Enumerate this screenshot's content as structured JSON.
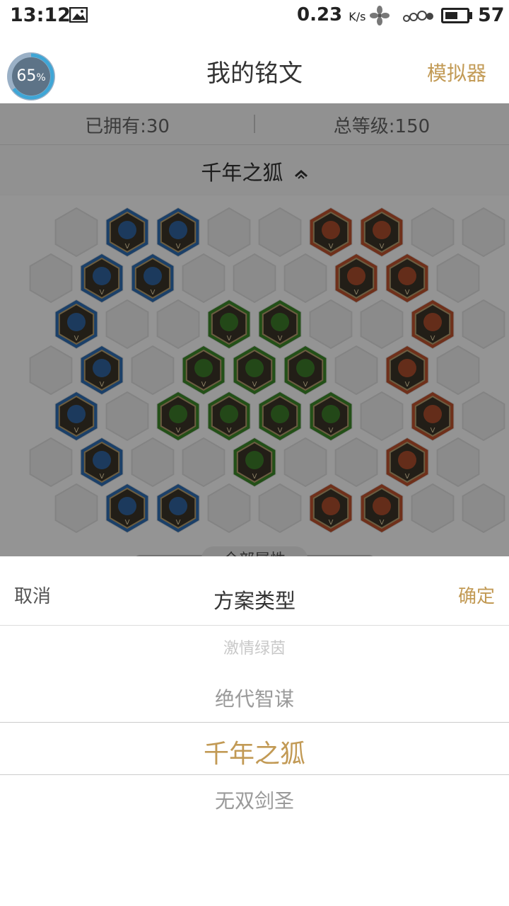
{
  "status_bar": {
    "time": "13:12",
    "net_speed": "0.23",
    "net_speed_unit": "K/s",
    "battery_level": "57",
    "battery_fraction": 0.57
  },
  "header": {
    "progress_value": "65",
    "progress_unit": "%",
    "progress_fraction": 0.65,
    "title": "我的铭文",
    "simulator_label": "模拟器"
  },
  "summary": {
    "owned": "已拥有:30",
    "total_level": "总等级:150"
  },
  "scheme": {
    "current": "千年之狐",
    "toggle_icon": "chevron-up-icon"
  },
  "attributes_tab": "全部属性",
  "inscription_colors": {
    "blue": "#2f6fb5",
    "green": "#3d8a2a",
    "red": "#c0532f"
  },
  "sheet": {
    "cancel_label": "取消",
    "title": "方案类型",
    "confirm_label": "确定",
    "options": [
      "激情绿茵",
      "绝代智谋",
      "千年之狐",
      "无双剑圣"
    ],
    "selected_index": 2
  },
  "colors": {
    "accent": "#c29a55"
  }
}
